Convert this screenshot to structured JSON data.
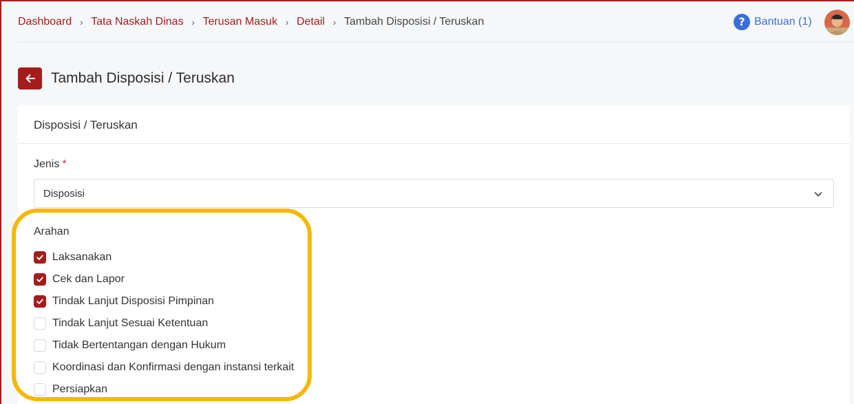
{
  "breadcrumb": {
    "items": [
      {
        "label": "Dashboard"
      },
      {
        "label": "Tata Naskah Dinas"
      },
      {
        "label": "Terusan Masuk"
      },
      {
        "label": "Detail"
      }
    ],
    "current": "Tambah Disposisi / Teruskan",
    "separator": "›"
  },
  "help": {
    "icon_glyph": "?",
    "label": "Bantuan (1)",
    "icon": "question-circle-icon"
  },
  "page": {
    "title": "Tambah Disposisi / Teruskan",
    "back_icon": "arrow-left-icon"
  },
  "card": {
    "title": "Disposisi / Teruskan",
    "jenis": {
      "label": "Jenis",
      "required_mark": "*",
      "value": "Disposisi"
    },
    "arahan": {
      "label": "Arahan",
      "options": [
        {
          "label": "Laksanakan",
          "checked": true
        },
        {
          "label": "Cek dan Lapor",
          "checked": true
        },
        {
          "label": "Tindak Lanjut Disposisi Pimpinan",
          "checked": true
        },
        {
          "label": "Tindak Lanjut Sesuai Ketentuan",
          "checked": false
        },
        {
          "label": "Tidak Bertentangan dengan Hukum",
          "checked": false
        },
        {
          "label": "Koordinasi dan Konfirmasi dengan instansi terkait",
          "checked": false
        },
        {
          "label": "Persiapkan",
          "checked": false
        }
      ]
    }
  },
  "colors": {
    "accent": "#a61c1c",
    "link": "#3a6fd8",
    "highlight": "#f5b800"
  }
}
